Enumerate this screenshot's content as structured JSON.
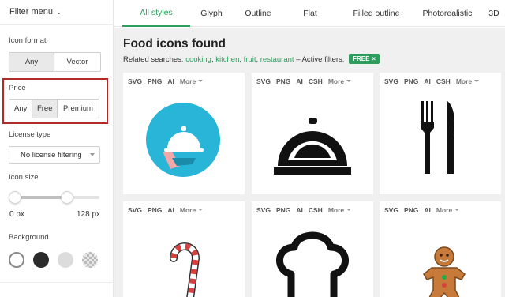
{
  "sidebar": {
    "filter_menu": "Filter menu",
    "icon_format": {
      "label": "Icon format",
      "options": [
        "Any",
        "Vector"
      ],
      "selected": "Any"
    },
    "price": {
      "label": "Price",
      "options": [
        "Any",
        "Free",
        "Premium"
      ],
      "selected": "Free"
    },
    "license": {
      "label": "License type",
      "value": "No license filtering"
    },
    "icon_size": {
      "label": "Icon size",
      "min_label": "0 px",
      "max_label": "128 px"
    },
    "background": {
      "label": "Background",
      "swatches": [
        "white",
        "black",
        "grey",
        "transparent"
      ]
    }
  },
  "tabs": [
    {
      "label": "All styles",
      "active": true
    },
    {
      "label": "Glyph",
      "active": false
    },
    {
      "label": "Outline",
      "active": false
    },
    {
      "label": "Flat",
      "active": false
    },
    {
      "label": "Filled outline",
      "active": false
    },
    {
      "label": "Photorealistic",
      "active": false
    },
    {
      "label": "3D",
      "active": false
    }
  ],
  "main": {
    "heading": "Food icons found",
    "related_prefix": "Related searches:",
    "related": [
      "cooking",
      "kitchen",
      "fruit",
      "restaurant"
    ],
    "filters_prefix": "– Active filters:",
    "badge": "FREE",
    "badge_close": "×"
  },
  "cards": [
    {
      "formats": [
        "SVG",
        "PNG",
        "AI"
      ],
      "more": "More",
      "icon": "cloche-circle-icon"
    },
    {
      "formats": [
        "SVG",
        "PNG",
        "AI",
        "CSH"
      ],
      "more": "More",
      "icon": "cloche-icon"
    },
    {
      "formats": [
        "SVG",
        "PNG",
        "AI",
        "CSH"
      ],
      "more": "More",
      "icon": "fork-knife-icon"
    },
    {
      "formats": [
        "SVG",
        "PNG",
        "AI"
      ],
      "more": "More",
      "icon": "candy-cane-icon"
    },
    {
      "formats": [
        "SVG",
        "PNG",
        "AI",
        "CSH"
      ],
      "more": "More",
      "icon": "chef-hat-icon"
    },
    {
      "formats": [
        "SVG",
        "PNG",
        "AI"
      ],
      "more": "More",
      "icon": "gingerbread-man-icon"
    }
  ],
  "colors": {
    "accent": "#2c9d5d",
    "highlight_border": "#b02a2a",
    "cloche_circle": "#29b5d8"
  }
}
